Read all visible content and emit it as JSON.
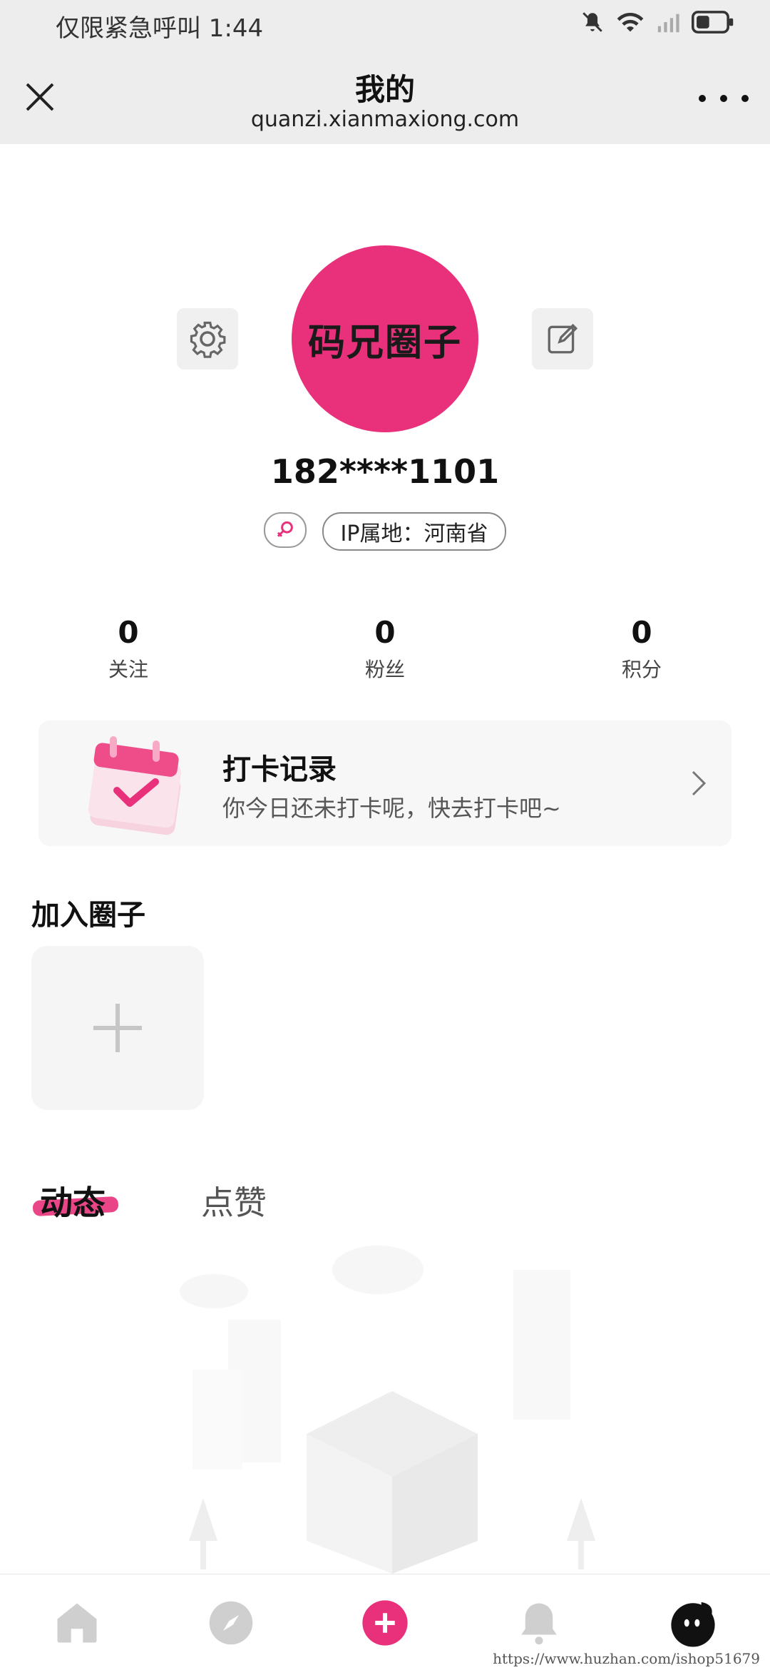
{
  "status_bar": {
    "text": "仅限紧急呼叫 1:44"
  },
  "header": {
    "title": "我的",
    "url": "quanzi.xianmaxiong.com"
  },
  "profile": {
    "avatar_text": "码兄圈子",
    "username": "182****1101",
    "ip_location": "IP属地：河南省"
  },
  "stats": [
    {
      "value": "0",
      "label": "关注"
    },
    {
      "value": "0",
      "label": "粉丝"
    },
    {
      "value": "0",
      "label": "积分"
    }
  ],
  "checkin": {
    "title": "打卡记录",
    "subtitle": "你今日还未打卡呢，快去打卡吧~"
  },
  "join_circle": {
    "title": "加入圈子"
  },
  "tabs": [
    {
      "label": "动态"
    },
    {
      "label": "点赞"
    }
  ],
  "watermark": "https://www.huzhan.com/ishop51679",
  "colors": {
    "accent": "#e8317a",
    "header_bg": "#ededed"
  }
}
